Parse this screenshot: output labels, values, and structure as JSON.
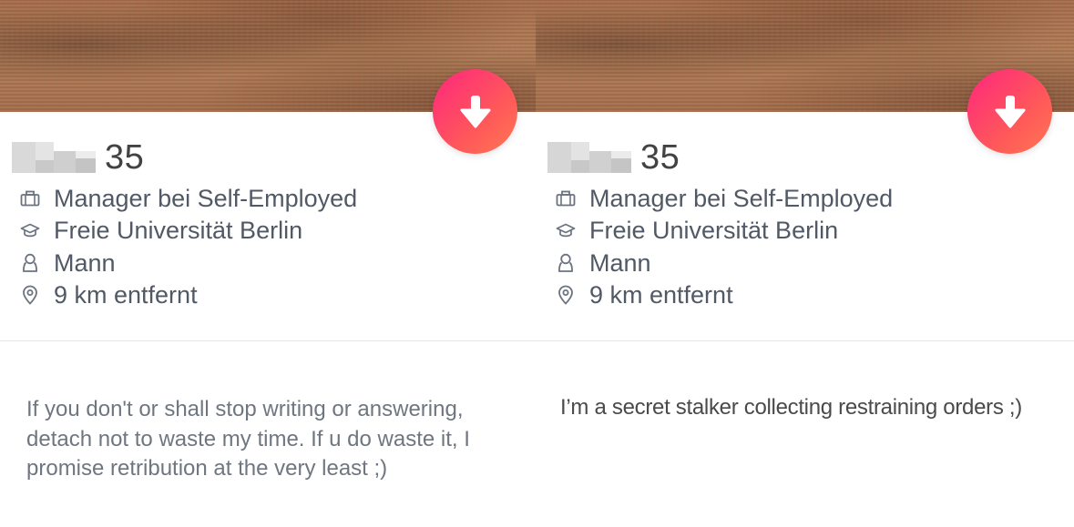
{
  "colors": {
    "accent_start": "#fd267d",
    "accent_end": "#ff7854",
    "text_primary": "#424242",
    "text_secondary": "#505965",
    "bio_text": "#6f7680"
  },
  "profiles": [
    {
      "age": "35",
      "job": "Manager bei Self-Employed",
      "school": "Freie Universität Berlin",
      "gender": "Mann",
      "distance": "9 km entfernt",
      "bio": "If you don't or shall stop writing or answering, detach not to waste my time. If u do waste it, I promise retribution at the very least ;)",
      "action_icon": "arrow-down-icon"
    },
    {
      "age": "35",
      "job": "Manager bei Self-Employed",
      "school": "Freie Universität Berlin",
      "gender": "Mann",
      "distance": "9 km entfernt",
      "bio": "I’m a secret stalker collecting restraining orders ;)",
      "action_icon": "arrow-down-icon"
    }
  ]
}
